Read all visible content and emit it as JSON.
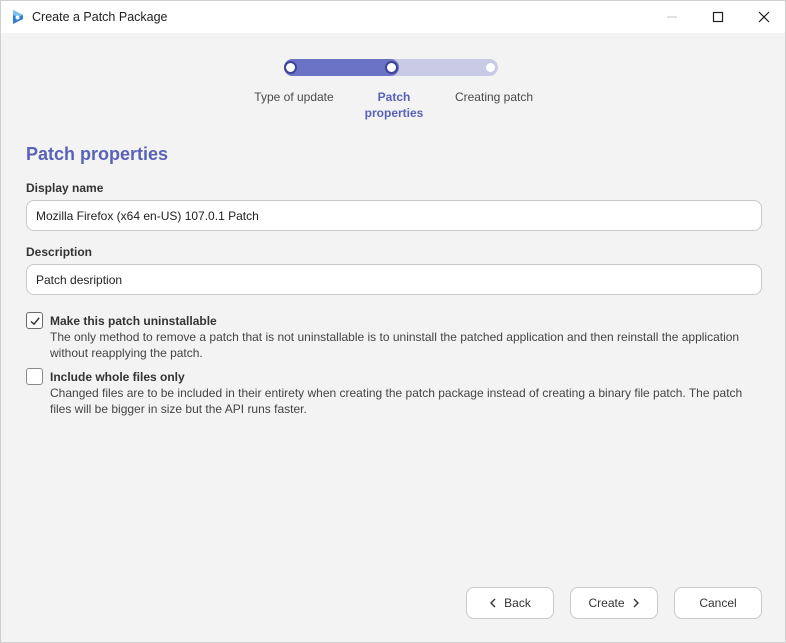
{
  "window": {
    "title": "Create a Patch Package"
  },
  "stepper": {
    "steps": [
      {
        "label": "Type of update"
      },
      {
        "label_line1": "Patch",
        "label_line2": "properties"
      },
      {
        "label": "Creating patch"
      }
    ],
    "progress": 0.5
  },
  "section": {
    "title": "Patch properties"
  },
  "display_name": {
    "label": "Display name",
    "value": "Mozilla Firefox (x64 en-US) 107.0.1 Patch"
  },
  "description": {
    "label": "Description",
    "value": "Patch desription"
  },
  "options": [
    {
      "title": "Make this patch uninstallable",
      "checked": true,
      "desc_line1": "The only method to remove a patch that is not uninstallable is to uninstall the patched application and then reinstall the application",
      "desc_line2": "without reapplying the patch."
    },
    {
      "title": "Include whole files only",
      "checked": false,
      "desc_line1": "Changed files are to be included in their entirety when creating the patch package instead of creating a binary file patch. The patch",
      "desc_line2": "files will be bigger in size but the API runs faster."
    }
  ],
  "buttons": {
    "back": "Back",
    "create": "Create",
    "cancel": "Cancel"
  },
  "icons": {
    "app": "patch-package-app-icon",
    "back": "chevron-left-icon",
    "create": "chevron-right-icon",
    "checkbox": "checkmark-icon"
  },
  "colors": {
    "accent": "#5a62b8",
    "stepper_fill": "#6b73c6",
    "stepper_track": "#c9cbe6"
  }
}
